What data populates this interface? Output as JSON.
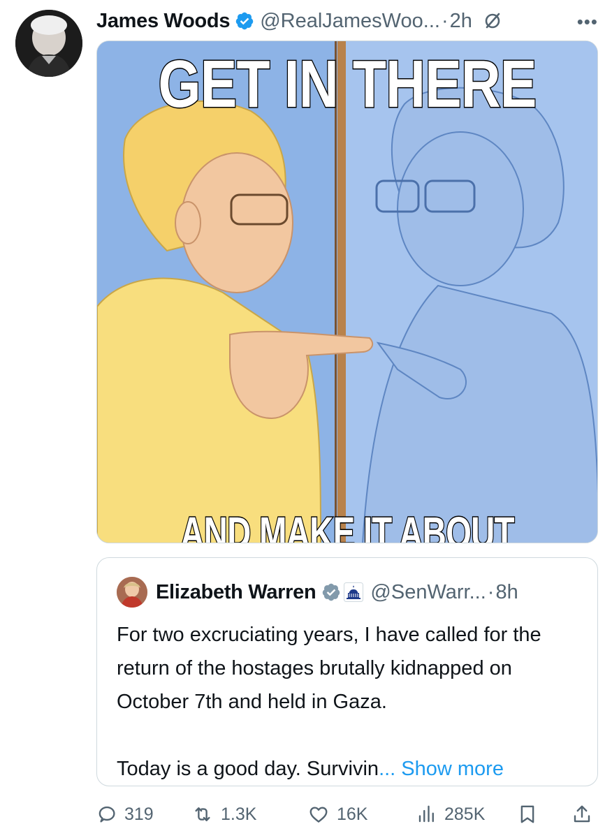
{
  "post": {
    "author": {
      "name": "James Woods",
      "handle": "@RealJamesWoo...",
      "time": "2h",
      "separator": "·"
    },
    "meme": {
      "top_text": "GET IN THERE",
      "bottom_text": "AND MAKE IT ABOUT YOU"
    },
    "quoted": {
      "name": "Elizabeth Warren",
      "handle": "@SenWarr...",
      "time": "8h",
      "separator": "·",
      "text_line1": "For two excruciating years, I have called for the return of the hostages brutally kidnapped on October 7th and held in Gaza.",
      "text_line2": "Today is a good day. Survivin",
      "ellipsis": "...",
      "show_more": "Show more"
    },
    "stats": {
      "replies": "319",
      "reposts": "1.3K",
      "likes": "16K",
      "views": "285K"
    }
  },
  "colors": {
    "accent": "#1d9bf0",
    "secondary_text": "#536471",
    "border": "#cfd9de",
    "verified_blue": "#1d9bf0",
    "verified_gray": "#829aab"
  },
  "icons": {
    "verified": "verified-badge-icon",
    "grok": "grok-icon",
    "more": "more-icon",
    "capitol": "capitol-icon",
    "reply": "reply-icon",
    "retweet": "retweet-icon",
    "like": "heart-icon",
    "views": "views-icon",
    "bookmark": "bookmark-icon",
    "share": "share-icon"
  }
}
